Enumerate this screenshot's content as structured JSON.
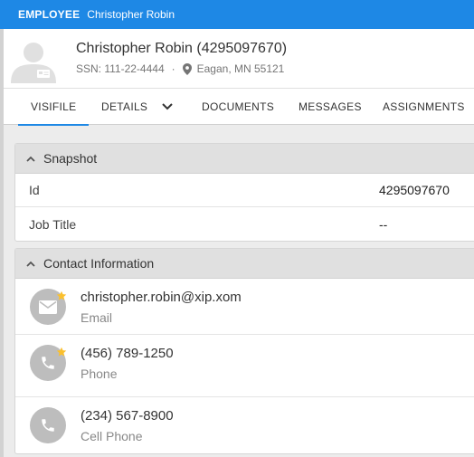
{
  "topbar": {
    "kind": "EMPLOYEE",
    "name": "Christopher Robin"
  },
  "employee": {
    "name": "Christopher Robin (4295097670)",
    "ssn": "SSN: 111-22-4444",
    "separator": "·",
    "location": "Eagan, MN 55121"
  },
  "tabs": [
    {
      "label": "VISIFILE",
      "active": true
    },
    {
      "label": "DETAILS",
      "active": false
    },
    {
      "label": "DOCUMENTS",
      "active": false
    },
    {
      "label": "MESSAGES",
      "active": false
    },
    {
      "label": "ASSIGNMENTS",
      "active": false
    }
  ],
  "snapshot": {
    "title": "Snapshot",
    "rows": [
      {
        "label": "Id",
        "value": "4295097670"
      },
      {
        "label": "Job Title",
        "value": "--"
      }
    ]
  },
  "contact": {
    "title": "Contact Information",
    "items": [
      {
        "value": "christopher.robin@xip.xom",
        "label": "Email",
        "icon": "email-icon",
        "primary": true
      },
      {
        "value": "(456) 789-1250",
        "label": "Phone",
        "icon": "phone-icon",
        "primary": true
      },
      {
        "value": "(234) 567-8900",
        "label": "Cell Phone",
        "icon": "phone-icon",
        "primary": false
      }
    ]
  },
  "colors": {
    "topbar": "#1e88e5",
    "active_tab": "#1e88e5",
    "star": "#fbc02d",
    "icon_circle": "#bdbdbd"
  }
}
